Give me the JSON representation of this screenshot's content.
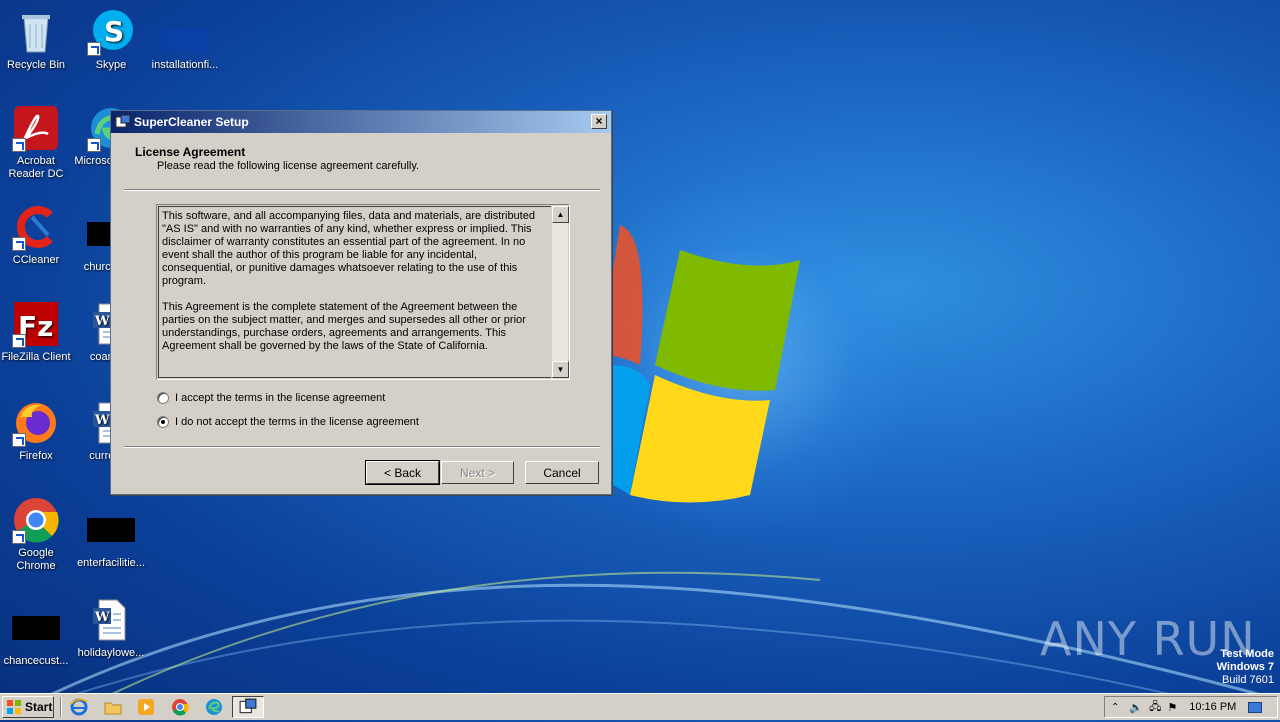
{
  "desktop": {
    "icons": [
      {
        "label": "Recycle Bin"
      },
      {
        "label": "Skype"
      },
      {
        "label": "installationfi..."
      },
      {
        "label": "Acrobat Reader DC"
      },
      {
        "label": "Microsoft Edge"
      },
      {
        "label": "CCleaner"
      },
      {
        "label": "churchon..."
      },
      {
        "label": "FileZilla Client"
      },
      {
        "label": "coanot..."
      },
      {
        "label": "Firefox"
      },
      {
        "label": "current..."
      },
      {
        "label": "Google Chrome"
      },
      {
        "label": "enterfacilitie..."
      },
      {
        "label": "chancecust..."
      },
      {
        "label": "holidaylowe..."
      }
    ]
  },
  "dialog": {
    "title": "SuperCleaner Setup",
    "close_label": "×",
    "header_title": "License Agreement",
    "header_subtitle": "Please read the following license agreement carefully.",
    "license_paragraphs": [
      "This software, and all accompanying files, data and materials, are distributed \"AS IS\" and with no warranties of any kind, whether express or implied. This disclaimer of warranty constitutes an essential part of the agreement. In no event shall the author of this program be liable for any incidental, consequential, or punitive damages whatsoever relating to the use of this program.",
      "This Agreement is the complete statement of the Agreement between the parties on the subject matter, and merges and supersedes all other or prior understandings, purchase orders, agreements and arrangements. This Agreement shall be governed by the laws of the State of California."
    ],
    "radio_accept": "I accept the terms in the license agreement",
    "radio_decline": "I do not accept the terms in the license agreement",
    "selected_option": "decline",
    "back_label": "< Back",
    "next_label": "Next >",
    "cancel_label": "Cancel"
  },
  "taskbar": {
    "start_label": "Start",
    "clock": "10:16 PM"
  },
  "watermark": {
    "line1": "Test Mode",
    "line2": "Windows 7",
    "line3": "Build 7601",
    "brand": "ANY RUN"
  },
  "colors": {
    "title_gradient_start": "#0a246a",
    "title_gradient_end": "#a6caf0",
    "dialog_face": "#d4d0c8"
  }
}
